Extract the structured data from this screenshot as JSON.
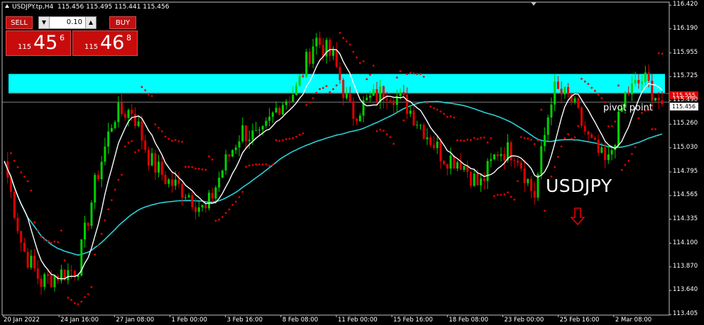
{
  "header": {
    "symbol_line": "USDJPY.tp,H4",
    "ohlc": "115.456 115.495 115.441 115.456"
  },
  "trade_panel": {
    "sell_label": "SELL",
    "buy_label": "BUY",
    "lot_value": "0.10",
    "sell_quote": {
      "prefix": "115",
      "big": "45",
      "sup": "6"
    },
    "buy_quote": {
      "prefix": "115",
      "big": "46",
      "sup": "8"
    }
  },
  "annotations": {
    "pivot_label": "pivot point",
    "symbol_label": "USDJPY"
  },
  "price_tags": {
    "resistance_line": "115.555",
    "current_price": "115.456"
  },
  "colors": {
    "bull": "#00d000",
    "bear": "#e00000",
    "zone": "#00ffff",
    "ma_slow": "#2ad0d8",
    "ma_fast": "#ffffff",
    "psar": "#e00000",
    "grid": "#808080"
  },
  "chart_data": {
    "type": "candlestick",
    "timeframe": "H4",
    "ylim": [
      113.4,
      116.45
    ],
    "y_ticks": [
      "116.420",
      "116.190",
      "115.955",
      "115.725",
      "115.490",
      "115.260",
      "115.030",
      "114.795",
      "114.565",
      "114.335",
      "114.100",
      "113.870",
      "113.640",
      "113.405"
    ],
    "x_ticks": [
      "20 Jan 2022",
      "24 Jan 16:00",
      "27 Jan 08:00",
      "1 Feb 00:00",
      "3 Feb 16:00",
      "8 Feb 08:00",
      "11 Feb 00:00",
      "15 Feb 16:00",
      "18 Feb 08:00",
      "23 Feb 00:00",
      "25 Feb 16:00",
      "2 Mar 08:00"
    ],
    "resistance_zone": [
      115.56,
      115.75
    ],
    "pivot_level": 115.475,
    "anchors": [
      {
        "date": "20 Jan",
        "p": 114.9
      },
      {
        "date": "21 Jan",
        "p": 114.05
      },
      {
        "date": "24 Jan 00:00",
        "p": 113.72
      },
      {
        "date": "24 Jan 16:00",
        "p": 113.8
      },
      {
        "date": "25 Jan",
        "p": 113.85
      },
      {
        "date": "26 Jan",
        "p": 114.7
      },
      {
        "date": "27 Jan 08:00",
        "p": 115.35
      },
      {
        "date": "28 Jan",
        "p": 115.4
      },
      {
        "date": "31 Jan",
        "p": 114.9
      },
      {
        "date": "1 Feb 00:00",
        "p": 114.7
      },
      {
        "date": "2 Feb",
        "p": 114.6
      },
      {
        "date": "3 Feb",
        "p": 114.4
      },
      {
        "date": "3 Feb 16:00",
        "p": 114.85
      },
      {
        "date": "4 Feb",
        "p": 115.2
      },
      {
        "date": "7 Feb",
        "p": 115.1
      },
      {
        "date": "8 Feb 08:00",
        "p": 115.45
      },
      {
        "date": "9 Feb",
        "p": 115.6
      },
      {
        "date": "10 Feb",
        "p": 116.1
      },
      {
        "date": "10 Feb 16:00",
        "p": 115.9
      },
      {
        "date": "11 Feb 00:00",
        "p": 115.35
      },
      {
        "date": "14 Feb",
        "p": 115.5
      },
      {
        "date": "15 Feb",
        "p": 115.6
      },
      {
        "date": "15 Feb 16:00",
        "p": 115.45
      },
      {
        "date": "16 Feb",
        "p": 115.2
      },
      {
        "date": "17 Feb",
        "p": 114.95
      },
      {
        "date": "18 Feb 08:00",
        "p": 114.9
      },
      {
        "date": "21 Feb",
        "p": 114.65
      },
      {
        "date": "22 Feb",
        "p": 115.0
      },
      {
        "date": "23 Feb 00:00",
        "p": 115.0
      },
      {
        "date": "24 Feb",
        "p": 114.55
      },
      {
        "date": "24 Feb 16:00",
        "p": 115.6
      },
      {
        "date": "25 Feb 16:00",
        "p": 115.5
      },
      {
        "date": "28 Feb",
        "p": 115.1
      },
      {
        "date": "1 Mar",
        "p": 114.85
      },
      {
        "date": "2 Mar 08:00",
        "p": 115.55
      },
      {
        "date": "2 Mar 16:00",
        "p": 115.7
      },
      {
        "date": "3 Mar",
        "p": 115.456
      }
    ],
    "series": [
      {
        "name": "fast MA",
        "type": "line"
      },
      {
        "name": "slow MA",
        "type": "line"
      },
      {
        "name": "Parabolic SAR",
        "type": "dots"
      }
    ]
  }
}
